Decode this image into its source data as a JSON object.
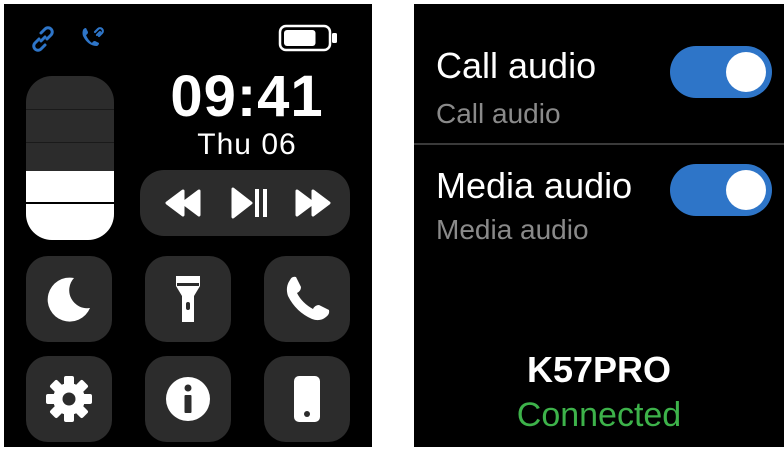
{
  "watch": {
    "time": "09:41",
    "date": "Thu  06",
    "brightness_level": 0.42,
    "battery_level": 0.75,
    "status_icons": [
      "link-icon",
      "phone-link-icon"
    ],
    "media_controls": [
      "rewind-icon",
      "play-pause-icon",
      "fast-forward-icon"
    ],
    "tiles": [
      "moon-icon",
      "flashlight-icon",
      "phone-icon",
      "gear-icon",
      "info-icon",
      "smartphone-icon"
    ],
    "colors": {
      "accent": "#2e75c8",
      "tile": "#2c2c2c"
    }
  },
  "audio_settings": {
    "call": {
      "title": "Call audio",
      "subtitle": "Call audio",
      "enabled": true
    },
    "media": {
      "title": "Media audio",
      "subtitle": "Media audio",
      "enabled": true
    },
    "device_name": "K57PRO",
    "status": "Connected",
    "colors": {
      "toggle_on": "#2e75c8",
      "connected": "#3db24a"
    }
  }
}
